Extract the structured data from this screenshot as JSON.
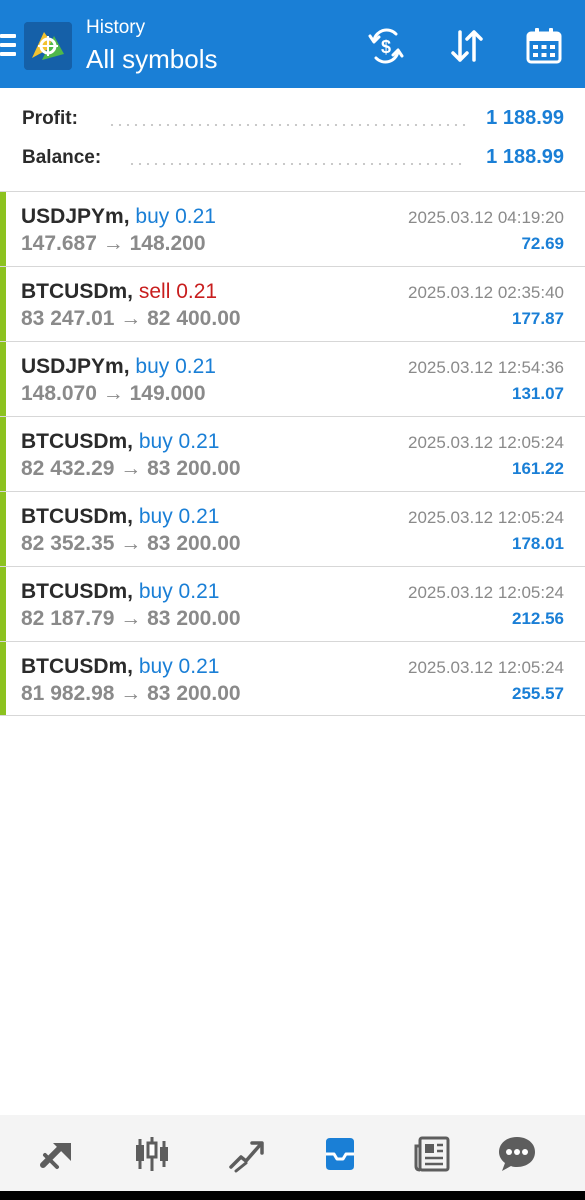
{
  "header": {
    "subtitle": "History",
    "title": "All symbols",
    "icons": [
      "menu-icon",
      "app-logo-icon",
      "deposit-withdraw-icon",
      "sort-icon",
      "calendar-icon"
    ]
  },
  "summary": {
    "profit_label": "Profit:",
    "profit_value": "1 188.99",
    "balance_label": "Balance:",
    "balance_value": "1 188.99"
  },
  "deals": [
    {
      "symbol": "USDJPYm,",
      "action": "buy 0.21",
      "type": "buy",
      "open": "147.687",
      "arrow": "→",
      "close": "148.200",
      "time": "2025.03.12 04:19:20",
      "profit": "72.69"
    },
    {
      "symbol": "BTCUSDm,",
      "action": "sell 0.21",
      "type": "sell",
      "open": "83 247.01",
      "arrow": "→",
      "close": "82 400.00",
      "time": "2025.03.12 02:35:40",
      "profit": "177.87"
    },
    {
      "symbol": "USDJPYm,",
      "action": "buy 0.21",
      "type": "buy",
      "open": "148.070",
      "arrow": "→",
      "close": "149.000",
      "time": "2025.03.12 12:54:36",
      "profit": "131.07"
    },
    {
      "symbol": "BTCUSDm,",
      "action": "buy 0.21",
      "type": "buy",
      "open": "82 432.29",
      "arrow": "→",
      "close": "83 200.00",
      "time": "2025.03.12 12:05:24",
      "profit": "161.22"
    },
    {
      "symbol": "BTCUSDm,",
      "action": "buy 0.21",
      "type": "buy",
      "open": "82 352.35",
      "arrow": "→",
      "close": "83 200.00",
      "time": "2025.03.12 12:05:24",
      "profit": "178.01"
    },
    {
      "symbol": "BTCUSDm,",
      "action": "buy 0.21",
      "type": "buy",
      "open": "82 187.79",
      "arrow": "→",
      "close": "83 200.00",
      "time": "2025.03.12 12:05:24",
      "profit": "212.56"
    },
    {
      "symbol": "BTCUSDm,",
      "action": "buy 0.21",
      "type": "buy",
      "open": "81 982.98",
      "arrow": "→",
      "close": "83 200.00",
      "time": "2025.03.12 12:05:24",
      "profit": "255.57"
    }
  ],
  "bottom_nav": {
    "items": [
      "quotes-icon",
      "chart-icon",
      "trade-icon",
      "history-icon",
      "news-icon",
      "messages-icon"
    ],
    "active": "history-icon"
  },
  "colors": {
    "accent": "#1a7fd6",
    "sell": "#c81e1e",
    "profit_bar": "#8cc21f",
    "nav_inactive": "#5d5d5d"
  }
}
